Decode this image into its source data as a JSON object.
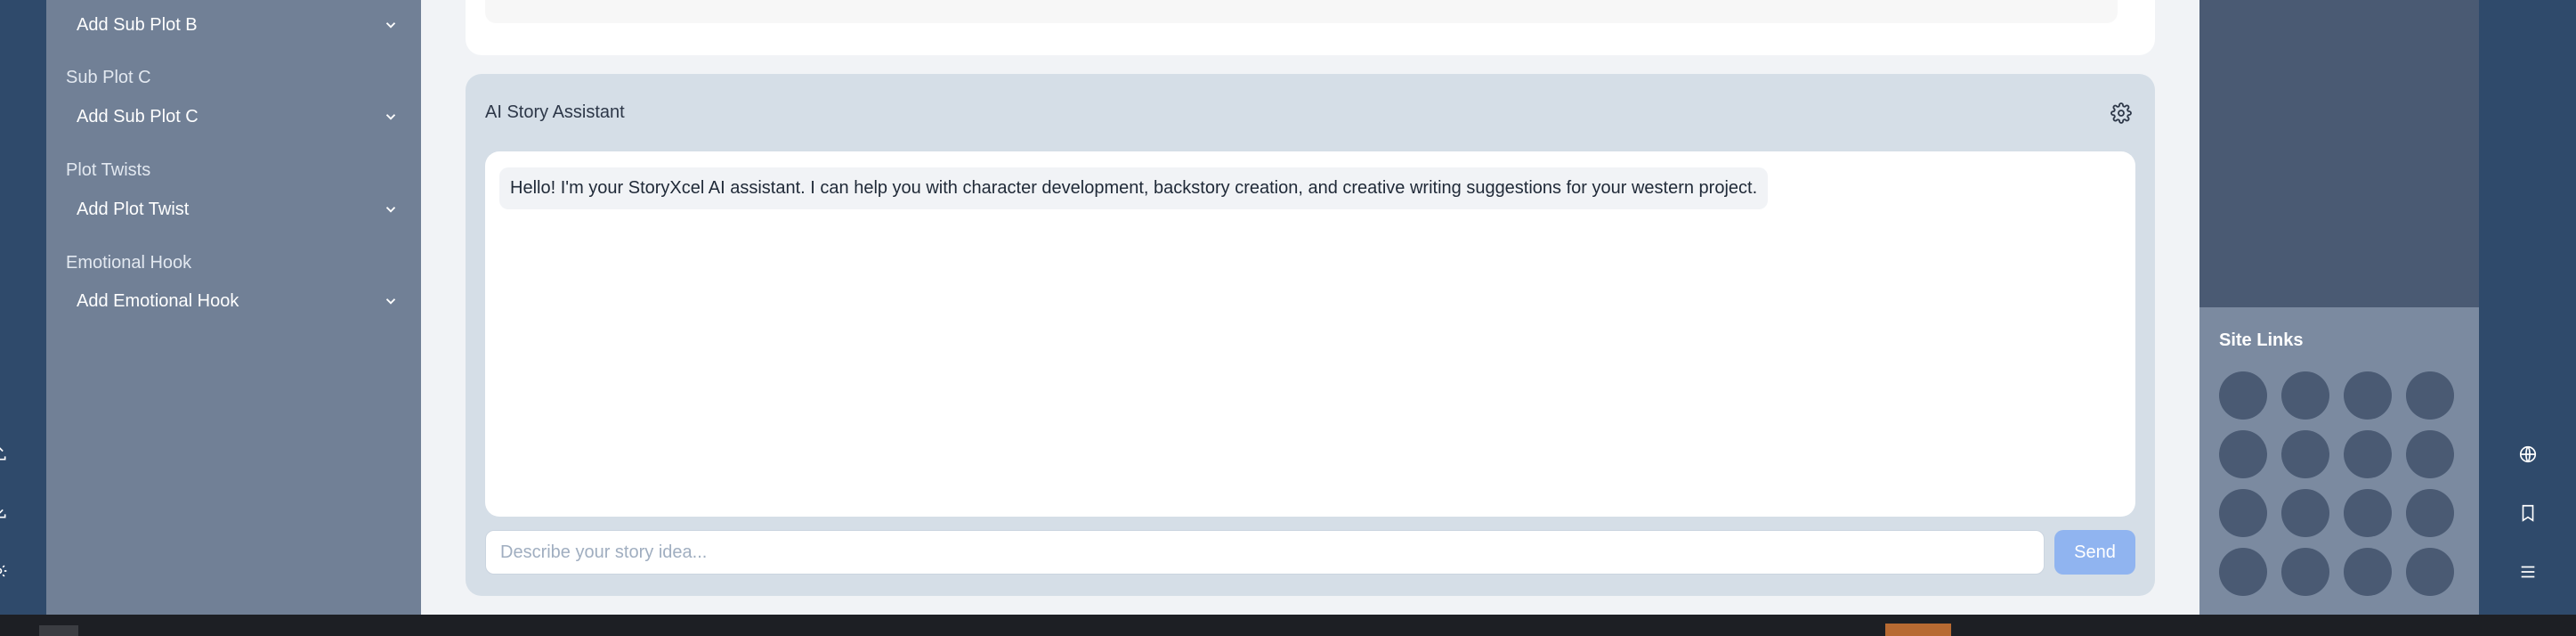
{
  "sidebar": {
    "sections": [
      {
        "label": "",
        "dropdown": "Add Sub Plot B"
      },
      {
        "label": "Sub Plot C",
        "dropdown": "Add Sub Plot C"
      },
      {
        "label": "Plot Twists",
        "dropdown": "Add Plot Twist"
      },
      {
        "label": "Emotional Hook",
        "dropdown": "Add Emotional Hook"
      }
    ]
  },
  "assistant": {
    "title": "AI Story Assistant",
    "message": "Hello! I'm your StoryXcel AI assistant. I can help you with character development, backstory creation, and creative writing suggestions for your western project.",
    "input_placeholder": "Describe your story idea...",
    "send_label": "Send"
  },
  "site_links": {
    "title": "Site Links"
  },
  "colors": {
    "rail": "#2f4a6b",
    "sidebar": "#718096",
    "assistant_bg": "#d5dee7",
    "send_button": "#90b4f0",
    "site_links_bg": "#7b8aa0",
    "link_circle": "#4a5a73"
  },
  "icons": {
    "left_rail": [
      "upload-icon",
      "download-icon",
      "settings-icon"
    ],
    "right_rail": [
      "globe-icon",
      "bookmark-icon",
      "menu-icon"
    ],
    "assistant_settings": "gear-icon",
    "dropdown": "chevron-down-icon"
  }
}
